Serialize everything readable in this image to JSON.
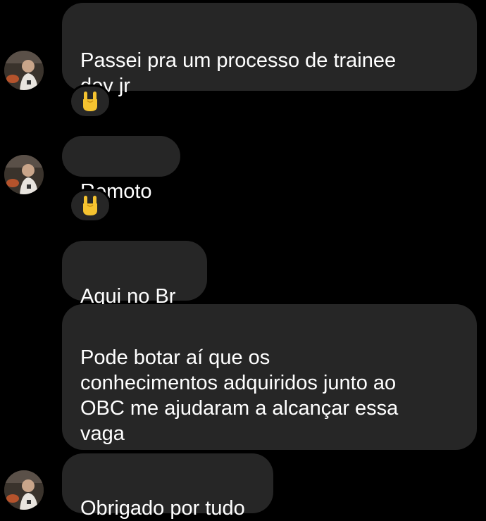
{
  "messages": [
    {
      "text": "Passei pra um processo de  trainee\ndev jr",
      "reaction": "rock-on-hand"
    },
    {
      "text": "Remoto",
      "reaction": "rock-on-hand"
    },
    {
      "text": "Aqui no Br"
    },
    {
      "text": "Pode botar aí que os\nconhecimentos adquiridos junto ao\nOBC me ajudaram a alcançar essa\nvaga"
    },
    {
      "text": "Obrigado por tudo"
    }
  ],
  "colors": {
    "background": "#000000",
    "bubble": "#262626",
    "text": "#ffffff",
    "reaction_emoji": "#f5c330"
  }
}
